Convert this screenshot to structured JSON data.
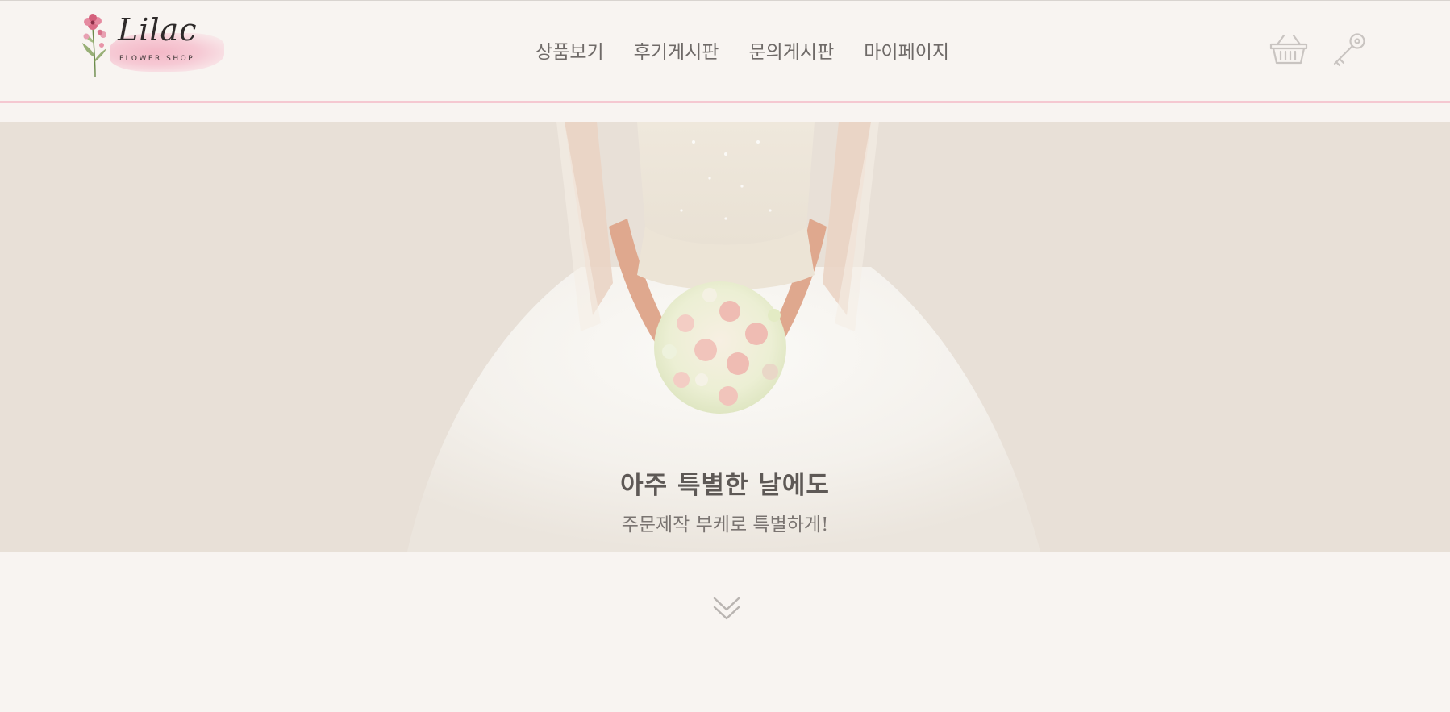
{
  "brand": {
    "logo_script": "Lilac",
    "logo_sub": "FLOWER SHOP"
  },
  "nav": {
    "items": [
      {
        "label": "상품보기"
      },
      {
        "label": "후기게시판"
      },
      {
        "label": "문의게시판"
      },
      {
        "label": "마이페이지"
      }
    ]
  },
  "header_icons": {
    "cart": "basket-icon",
    "login": "key-icon"
  },
  "hero": {
    "title": "아주 특별한 날에도",
    "subtitle": "주문제작 부케로 특별하게!"
  },
  "scroll": {
    "icon": "double-chevron-down-icon"
  },
  "colors": {
    "background": "#f8f4f1",
    "header_accent_line": "#f5c8d1",
    "hero_background": "#e8e0d7",
    "nav_text": "#6f6a68",
    "icon_stroke": "#c9c4c1"
  }
}
